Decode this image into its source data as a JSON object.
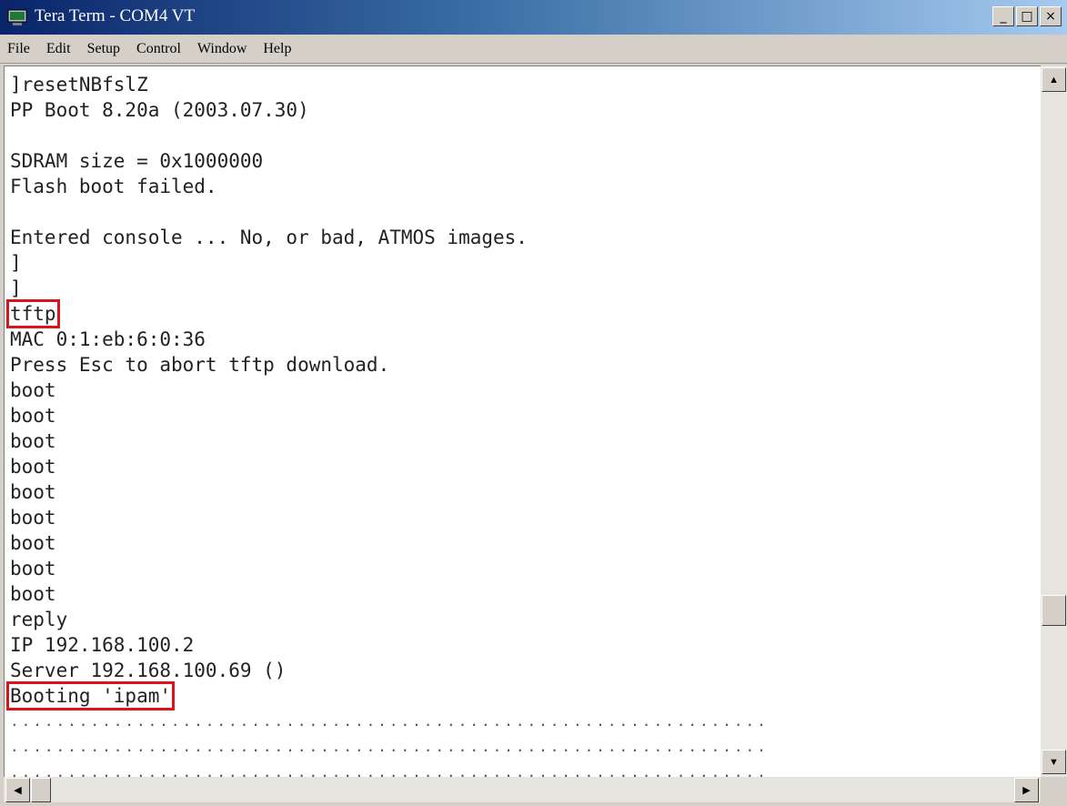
{
  "window": {
    "title": "Tera Term - COM4 VT"
  },
  "titlebar": {
    "minimize": "_",
    "maximize": "□",
    "close": "×"
  },
  "menu": [
    "File",
    "Edit",
    "Setup",
    "Control",
    "Window",
    "Help"
  ],
  "terminal": {
    "lines": [
      "]resetNBfslZ",
      "PP Boot 8.20a (2003.07.30)",
      "",
      "SDRAM size = 0x1000000",
      "Flash boot failed.",
      "",
      "Entered console ... No, or bad, ATMOS images.",
      "]",
      "]",
      "tftp",
      "MAC 0:1:eb:6:0:36",
      "Press Esc to abort tftp download.",
      "boot",
      "boot",
      "boot",
      "boot",
      "boot",
      "boot",
      "boot",
      "boot",
      "boot",
      "reply",
      "IP 192.168.100.2",
      "Server 192.168.100.69 ()",
      "Booting 'ipam'"
    ],
    "progress_lines": [
      "..................................................................",
      "..................................................................",
      ".................................................................."
    ]
  },
  "scrollbar": {
    "up": "▲",
    "down": "▼",
    "left": "◀",
    "right": "▶"
  }
}
